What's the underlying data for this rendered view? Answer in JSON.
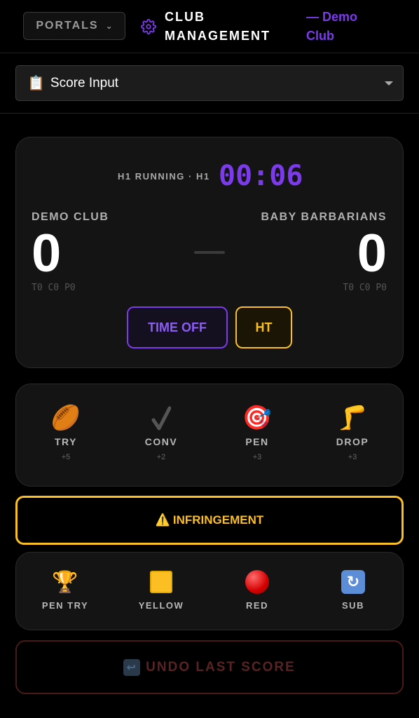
{
  "header": {
    "portals_label": "PORTALS",
    "title": "CLUB MANAGEMENT",
    "club_tag": "— Demo Club"
  },
  "view_select": {
    "icon": "clipboard-icon",
    "value": "Score Input"
  },
  "scoreboard": {
    "status": "H1 RUNNING · H1",
    "clock": "00:06",
    "home": {
      "name": "DEMO CLUB",
      "score": "0",
      "breakdown": "T0 C0 P0"
    },
    "away": {
      "name": "BABY BARBARIANS",
      "score": "0",
      "breakdown": "T0 C0 P0"
    },
    "time_off_label": "TIME OFF",
    "ht_label": "HT"
  },
  "scoring_actions": [
    {
      "label": "TRY",
      "points": "+5",
      "icon": "rugby-ball-icon"
    },
    {
      "label": "CONV",
      "points": "+2",
      "icon": "check-icon"
    },
    {
      "label": "PEN",
      "points": "+3",
      "icon": "target-icon"
    },
    {
      "label": "DROP",
      "points": "+3",
      "icon": "leg-icon"
    }
  ],
  "infringement_label": "INFRINGEMENT",
  "discipline_actions": [
    {
      "label": "PEN TRY",
      "icon": "trophy-icon"
    },
    {
      "label": "YELLOW",
      "icon": "yellow-card-icon"
    },
    {
      "label": "RED",
      "icon": "red-card-icon"
    },
    {
      "label": "SUB",
      "icon": "substitution-icon"
    }
  ],
  "undo_label": "UNDO LAST SCORE",
  "colors": {
    "accent_purple": "#7c3aed",
    "accent_yellow": "#fbbf24",
    "danger_dim": "#5a2323"
  }
}
